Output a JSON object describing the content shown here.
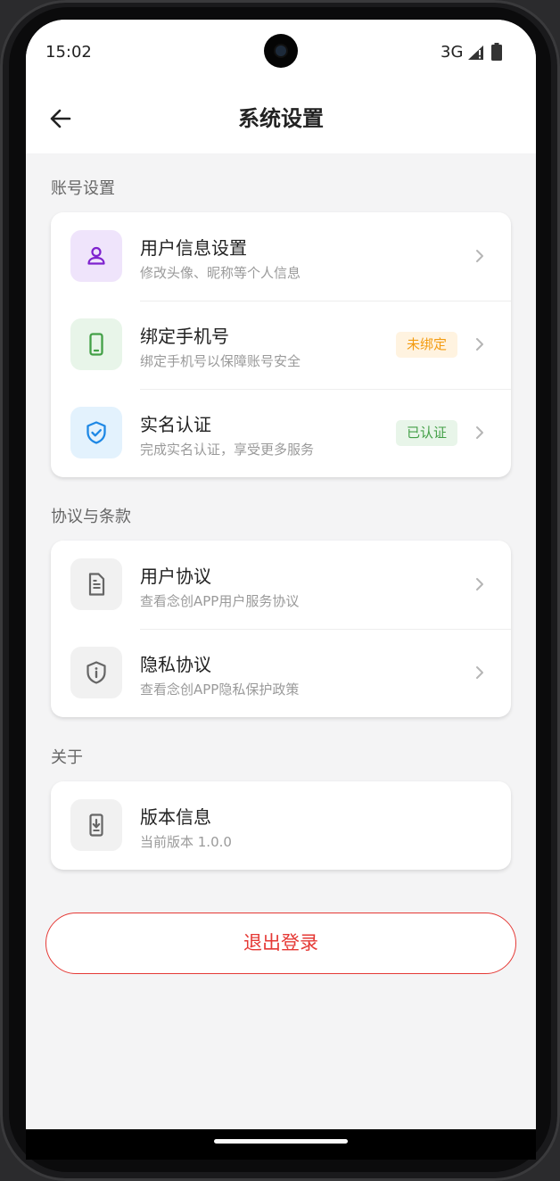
{
  "status": {
    "time": "15:02",
    "network": "3G"
  },
  "header": {
    "title": "系统设置"
  },
  "sections": [
    {
      "title": "账号设置",
      "items": [
        {
          "title": "用户信息设置",
          "subtitle": "修改头像、昵称等个人信息",
          "icon": "user-icon",
          "icon_bg": "#efe4fb",
          "icon_color": "#7e22ce"
        },
        {
          "title": "绑定手机号",
          "subtitle": "绑定手机号以保障账号安全",
          "icon": "phone-icon",
          "icon_bg": "#e8f5e9",
          "icon_color": "#43a047",
          "badge": {
            "text": "未绑定",
            "bg": "#fff3e0",
            "color": "#f39c12"
          }
        },
        {
          "title": "实名认证",
          "subtitle": "完成实名认证，享受更多服务",
          "icon": "shield-check-icon",
          "icon_bg": "#e3f2fd",
          "icon_color": "#1e88e5",
          "badge": {
            "text": "已认证",
            "bg": "#e8f5e9",
            "color": "#43a047"
          }
        }
      ]
    },
    {
      "title": "协议与条款",
      "items": [
        {
          "title": "用户协议",
          "subtitle": "查看念创APP用户服务协议",
          "icon": "document-icon",
          "icon_bg": "#f1f1f1",
          "icon_color": "#666666"
        },
        {
          "title": "隐私协议",
          "subtitle": "查看念创APP隐私保护政策",
          "icon": "privacy-shield-icon",
          "icon_bg": "#f1f1f1",
          "icon_color": "#666666"
        }
      ]
    },
    {
      "title": "关于",
      "items": [
        {
          "title": "版本信息",
          "subtitle": "当前版本 1.0.0",
          "icon": "app-update-icon",
          "icon_bg": "#f1f1f1",
          "icon_color": "#666666"
        }
      ]
    }
  ],
  "logout_label": "退出登录",
  "colors": {
    "accent_red": "#e53935",
    "background": "#f4f4f5"
  }
}
